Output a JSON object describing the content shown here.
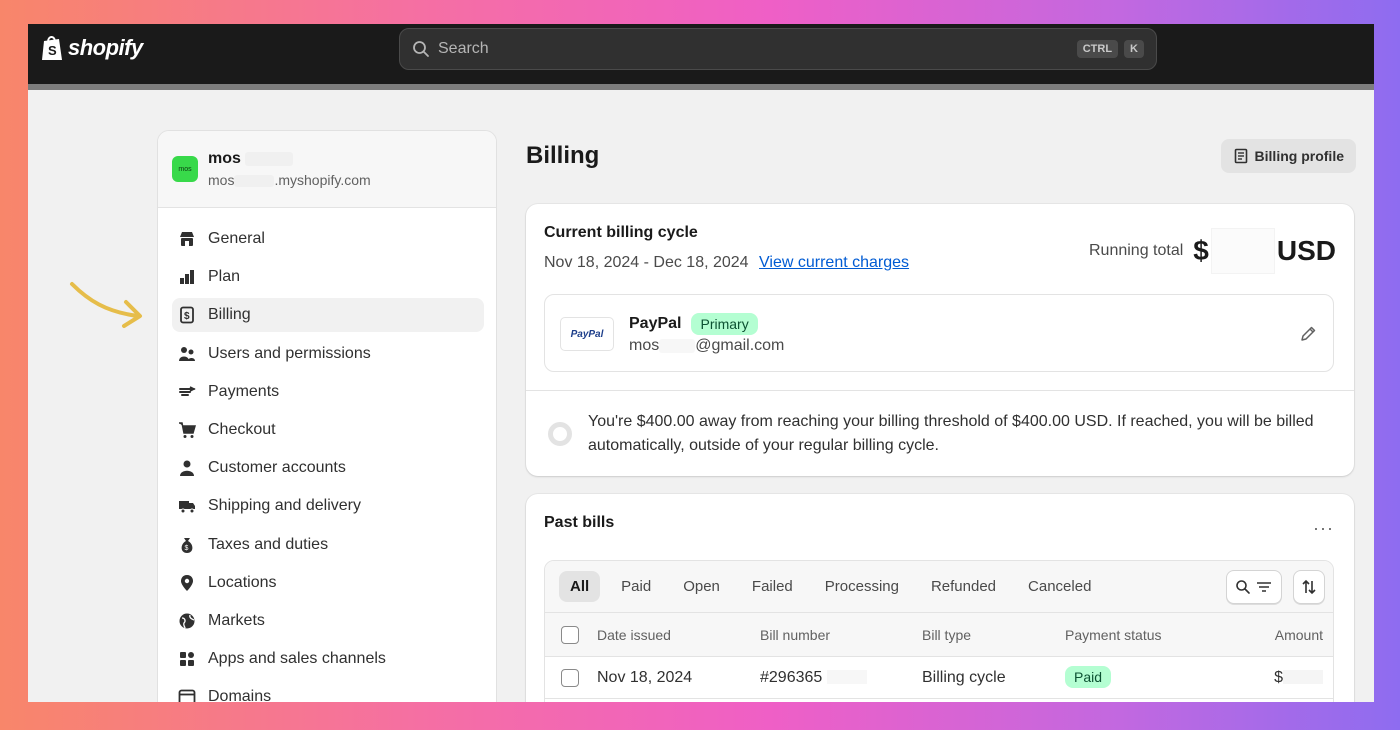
{
  "topbar": {
    "brand": "shopify",
    "search_placeholder": "Search",
    "shortcut_keys": [
      "CTRL",
      "K"
    ]
  },
  "sidebar": {
    "store_name": "mos",
    "store_domain_prefix": "mos",
    "store_domain_suffix": ".myshopify.com",
    "avatar_text": "mos",
    "items": [
      {
        "label": "General",
        "icon": "store-icon"
      },
      {
        "label": "Plan",
        "icon": "plan-icon"
      },
      {
        "label": "Billing",
        "icon": "receipt-icon",
        "active": true
      },
      {
        "label": "Users and permissions",
        "icon": "users-icon"
      },
      {
        "label": "Payments",
        "icon": "payments-icon"
      },
      {
        "label": "Checkout",
        "icon": "cart-icon"
      },
      {
        "label": "Customer accounts",
        "icon": "person-icon"
      },
      {
        "label": "Shipping and delivery",
        "icon": "truck-icon"
      },
      {
        "label": "Taxes and duties",
        "icon": "money-bag-icon"
      },
      {
        "label": "Locations",
        "icon": "location-pin-icon"
      },
      {
        "label": "Markets",
        "icon": "globe-icon"
      },
      {
        "label": "Apps and sales channels",
        "icon": "apps-icon"
      },
      {
        "label": "Domains",
        "icon": "domain-icon"
      }
    ]
  },
  "main": {
    "title": "Billing",
    "billing_profile_label": "Billing profile",
    "cycle": {
      "title": "Current billing cycle",
      "dates": "Nov 18, 2024 - Dec 18, 2024",
      "view_charges": "View current charges",
      "running_label": "Running total",
      "currency_symbol": "$",
      "currency": "USD"
    },
    "payment_method": {
      "logo_text": "PayPal",
      "name": "PayPal",
      "badge": "Primary",
      "email_prefix": "mos",
      "email_suffix": "@gmail.com"
    },
    "threshold_text": "You're $400.00 away from reaching your billing threshold of $400.00 USD. If reached, you will be billed automatically, outside of your regular billing cycle.",
    "past_bills": {
      "title": "Past bills",
      "more": "···",
      "tabs": [
        "All",
        "Paid",
        "Open",
        "Failed",
        "Processing",
        "Refunded",
        "Canceled"
      ],
      "columns": [
        "Date issued",
        "Bill number",
        "Bill type",
        "Payment status",
        "Amount"
      ],
      "rows": [
        {
          "date": "Nov 18, 2024",
          "bill_number": "#296365",
          "type": "Billing cycle",
          "status": "Paid",
          "amount": "$"
        }
      ]
    }
  },
  "colors": {
    "topbar_bg": "#1a1a1a",
    "page_bg": "#f1f1f1",
    "link": "#005bd3",
    "badge_green": "#b4fed2",
    "avatar_green": "#38d94a"
  }
}
